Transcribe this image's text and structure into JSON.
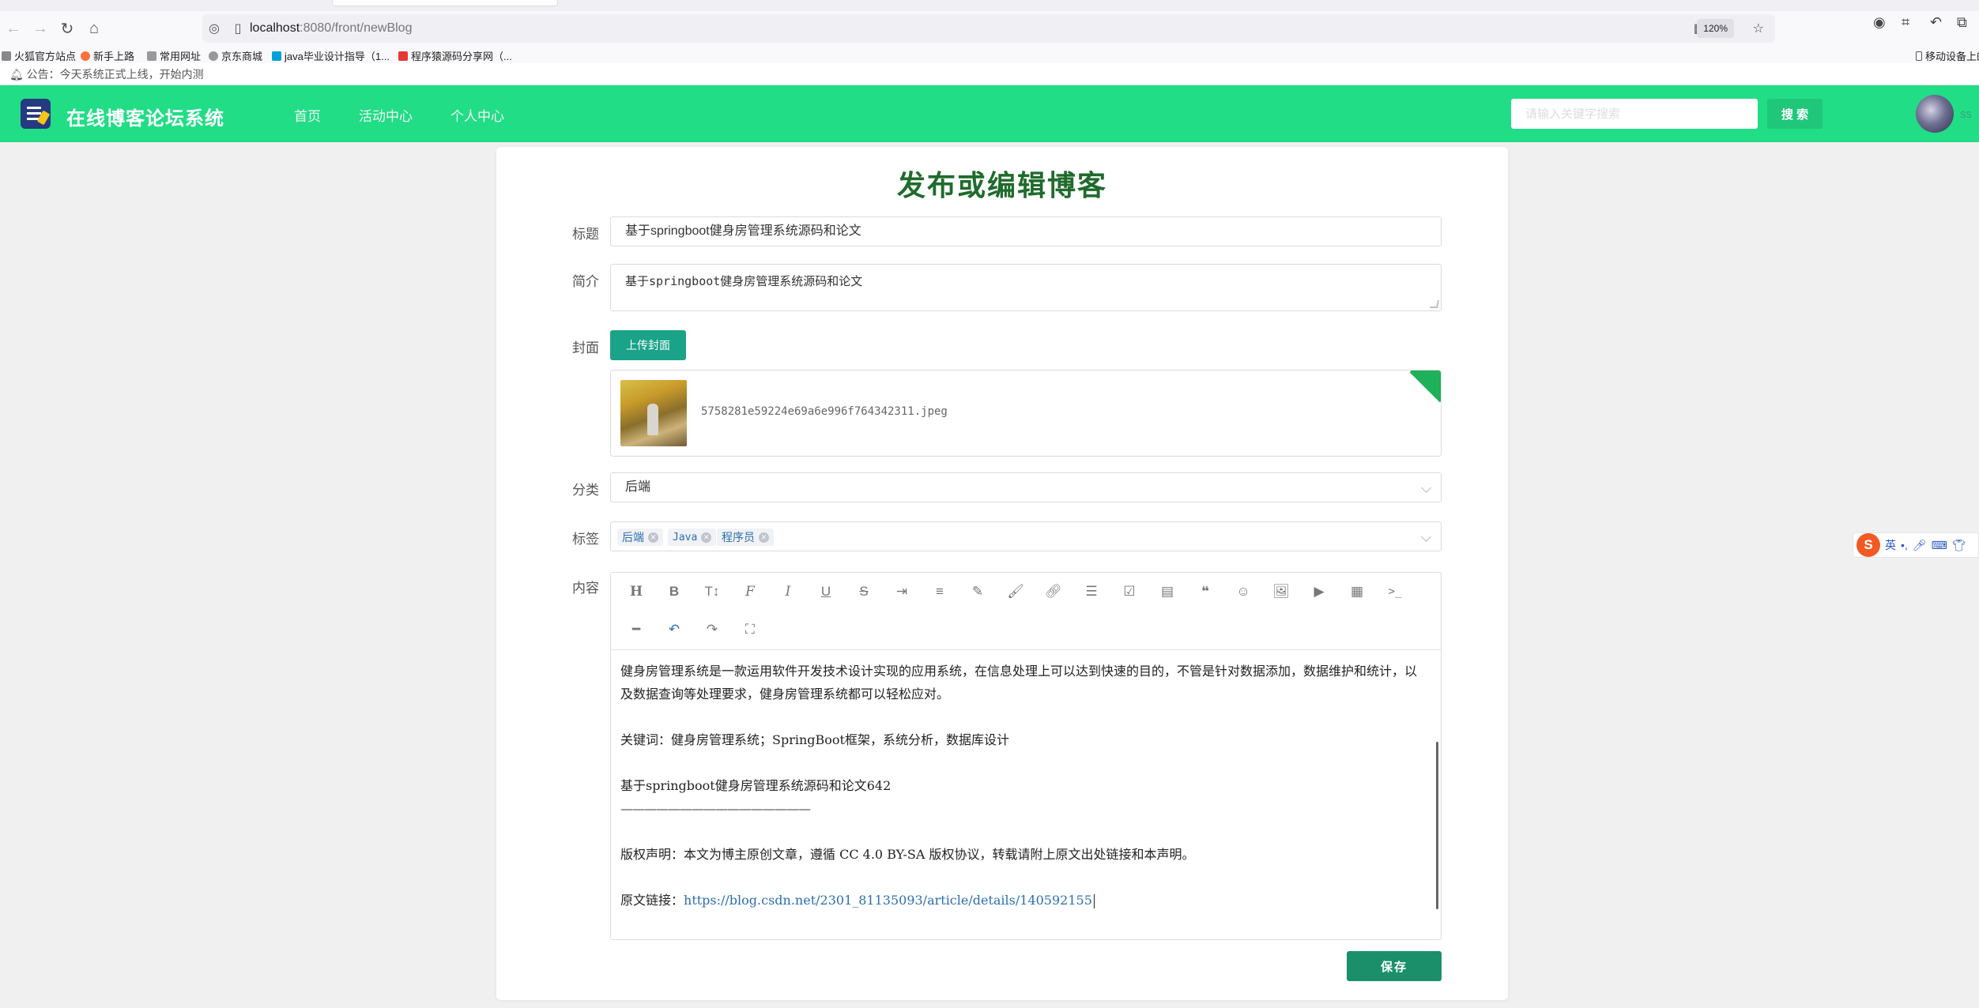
{
  "browser": {
    "url_host": "localhost",
    "url_path": ":8080/front/newBlog",
    "zoom": "120%",
    "bookmarks": [
      {
        "label": "火狐官方站点",
        "color": "#e66000"
      },
      {
        "label": "新手上路",
        "color": "#ff7139"
      },
      {
        "label": "常用网址",
        "color": "#666666"
      },
      {
        "label": "京东商城",
        "color": "#666666"
      },
      {
        "label": "java毕业设计指导（1...",
        "color": "#00a1d6"
      },
      {
        "label": "程序猿源码分享网（...",
        "color": "#e53935"
      }
    ],
    "bookmark_right": "移动设备上的"
  },
  "notice": {
    "text": "公告：今天系统正式上线，开始内测"
  },
  "header": {
    "site_title": "在线博客论坛系统",
    "nav": [
      "首页",
      "活动中心",
      "个人中心"
    ],
    "search_placeholder": "请输入关键字搜索",
    "search_button": "搜 索",
    "user_name": "ss"
  },
  "form": {
    "page_title": "发布或编辑博客",
    "title_label": "标题",
    "title_value": "基于springboot健身房管理系统源码和论文",
    "intro_label": "简介",
    "intro_value": "基于springboot健身房管理系统源码和论文",
    "cover_label": "封面",
    "upload_button": "上传封面",
    "cover_file": "5758281e59224e69a6e996f764342311.jpeg",
    "category_label": "分类",
    "category_value": "后端",
    "tags_label": "标签",
    "tags": [
      "后端",
      "Java",
      "程序员"
    ],
    "content_label": "内容",
    "content_paragraphs": [
      "健身房管理系统是一款运用软件开发技术设计实现的应用系统，在信息处理上可以达到快速的目的，不管是针对数据添加，数据维护和统计，以及数据查询等处理要求，健身房管理系统都可以轻松应对。",
      "关键词：健身房管理系统；SpringBoot框架，系统分析，数据库设计",
      "基于springboot健身房管理系统源码和论文642",
      "————————————————",
      "版权声明：本文为博主原创文章，遵循 CC 4.0 BY-SA 版权协议，转载请附上原文出处链接和本声明。",
      "原文链接：",
      "https://blog.csdn.net/2301_81135093/article/details/140592155"
    ],
    "save_button": "保存"
  },
  "ime": {
    "logo": "S",
    "mode": "英"
  },
  "colors": {
    "header_bg": "#21dd86",
    "save_btn": "#1b8f6a",
    "upload_btn": "#1ba38a",
    "title_color": "#1f6b2c"
  }
}
